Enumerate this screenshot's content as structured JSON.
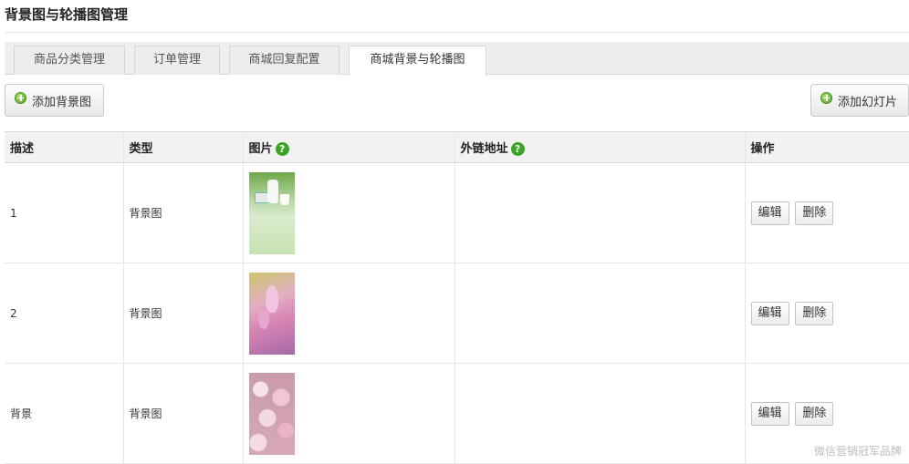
{
  "page": {
    "title": "背景图与轮播图管理"
  },
  "tabs": [
    {
      "label": "商品分类管理",
      "active": false
    },
    {
      "label": "订单管理",
      "active": false
    },
    {
      "label": "商城回复配置",
      "active": false
    },
    {
      "label": "商城背景与轮播图",
      "active": true
    }
  ],
  "toolbar": {
    "add_background_label": "添加背景图",
    "add_slide_label": "添加幻灯片"
  },
  "table": {
    "headers": {
      "description": "描述",
      "type": "类型",
      "image": "图片",
      "link": "外链地址",
      "actions": "操作"
    },
    "rows": [
      {
        "description": "1",
        "type": "背景图",
        "link": "",
        "edit": "编辑",
        "delete": "删除"
      },
      {
        "description": "2",
        "type": "背景图",
        "link": "",
        "edit": "编辑",
        "delete": "删除"
      },
      {
        "description": "背景",
        "type": "背景图",
        "link": "",
        "edit": "编辑",
        "delete": "删除"
      }
    ]
  },
  "help_icon_glyph": "?",
  "watermark": "微信营销冠军品牌",
  "colors": {
    "help_green": "#3aa524",
    "plus_green": "#4ea41d"
  }
}
